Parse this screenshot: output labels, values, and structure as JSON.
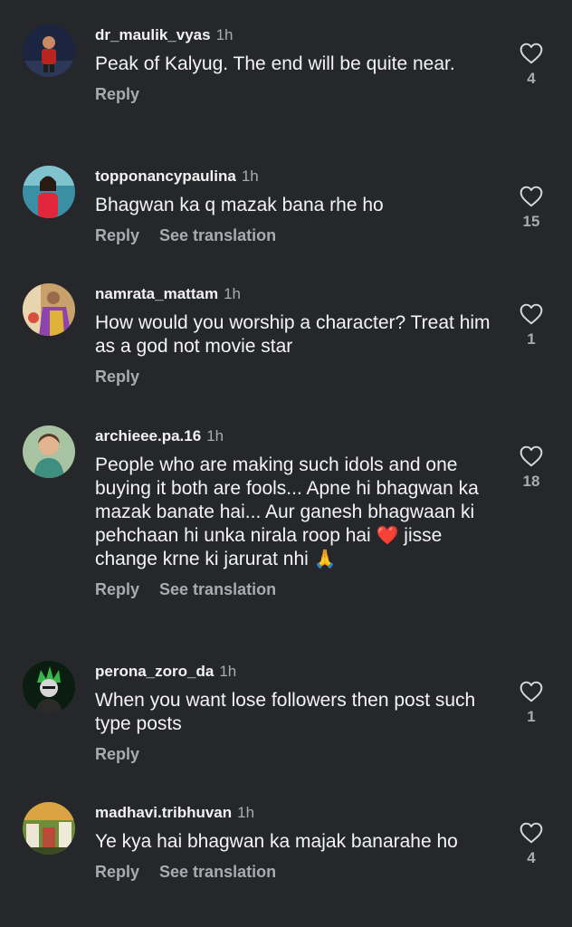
{
  "comments": [
    {
      "username": "dr_maulik_vyas",
      "time": "1h",
      "text": "Peak of Kalyug. The end will be quite near.",
      "reply_label": "Reply",
      "likes": "4",
      "avatar_colors": [
        "#1b2540",
        "#b8241f"
      ]
    },
    {
      "username": "topponancypaulina",
      "time": "1h",
      "text": "Bhagwan ka q mazak bana rhe ho",
      "reply_label": "Reply",
      "translate_label": "See translation",
      "likes": "15",
      "avatar_colors": [
        "#3b8fa5",
        "#e2263b"
      ]
    },
    {
      "username": "namrata_mattam",
      "time": "1h",
      "text": "How would you worship a character? Treat him as a god not movie star",
      "reply_label": "Reply",
      "likes": "1",
      "avatar_colors": [
        "#c9a16a",
        "#8e44ad"
      ]
    },
    {
      "username": "archieee.pa.16",
      "time": "1h",
      "text_parts": [
        "People who are making such idols and one buying it both are fools... Apne hi bhagwan ka mazak banate hai... Aur ganesh bhagwaan ki pehchaan hi unka nirala roop hai ",
        "❤️",
        " jisse change krne ki jarurat nhi ",
        "🙏"
      ],
      "reply_label": "Reply",
      "translate_label": "See translation",
      "likes": "18",
      "avatar_colors": [
        "#a7c3a2",
        "#5a3a26"
      ]
    },
    {
      "username": "perona_zoro_da",
      "time": "1h",
      "text": "When you want lose followers then post such type posts",
      "reply_label": "Reply",
      "likes": "1",
      "avatar_colors": [
        "#0b1c10",
        "#39b54a"
      ]
    },
    {
      "username": "madhavi.tribhuvan",
      "time": "1h",
      "text": "Ye kya hai bhagwan ka majak banarahe ho",
      "reply_label": "Reply",
      "translate_label": "See translation",
      "likes": "4",
      "avatar_colors": [
        "#6d8f3a",
        "#d9a441"
      ]
    }
  ],
  "icons": {
    "like": "heart-outline-icon"
  },
  "colors": {
    "background": "#25272b",
    "muted_text": "#a9abb0"
  }
}
